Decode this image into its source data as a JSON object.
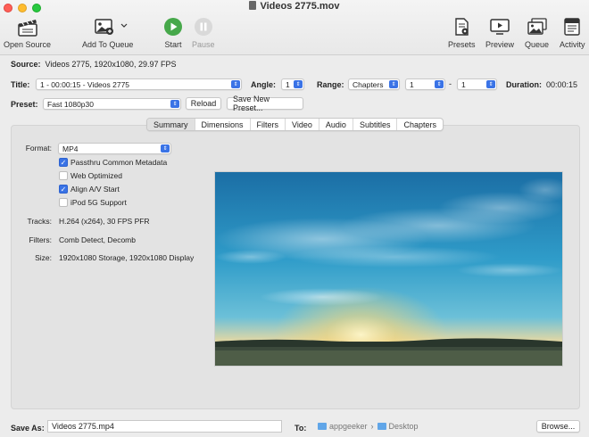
{
  "window": {
    "title": "Videos 2775.mov"
  },
  "toolbar": {
    "open_source": "Open Source",
    "add_to_queue": "Add To Queue",
    "start": "Start",
    "pause": "Pause",
    "presets": "Presets",
    "preview": "Preview",
    "queue": "Queue",
    "activity": "Activity"
  },
  "source": {
    "label": "Source:",
    "value": "Videos 2775, 1920x1080, 29.97 FPS"
  },
  "title_row": {
    "title_label": "Title:",
    "title_value": "1 - 00:00:15 - Videos 2775",
    "angle_label": "Angle:",
    "angle_value": "1",
    "range_label": "Range:",
    "range_value": "Chapters",
    "range_start": "1",
    "range_sep": "-",
    "range_end": "1",
    "duration_label": "Duration:",
    "duration_value": "00:00:15"
  },
  "preset": {
    "label": "Preset:",
    "value": "Fast 1080p30",
    "reload": "Reload",
    "save_new": "Save New Preset..."
  },
  "tabs": [
    "Summary",
    "Dimensions",
    "Filters",
    "Video",
    "Audio",
    "Subtitles",
    "Chapters"
  ],
  "summary": {
    "format_label": "Format:",
    "format_value": "MP4",
    "options": [
      {
        "label": "Passthru Common Metadata",
        "checked": true
      },
      {
        "label": "Web Optimized",
        "checked": false
      },
      {
        "label": "Align A/V Start",
        "checked": true
      },
      {
        "label": "iPod 5G Support",
        "checked": false
      }
    ],
    "tracks_label": "Tracks:",
    "tracks_value": "H.264 (x264), 30 FPS PFR",
    "filters_label": "Filters:",
    "filters_value": "Comb Detect, Decomb",
    "size_label": "Size:",
    "size_value": "1920x1080 Storage, 1920x1080 Display"
  },
  "save": {
    "label": "Save As:",
    "value": "Videos 2775.mp4",
    "to_label": "To:",
    "path": [
      "appgeeker",
      "Desktop"
    ],
    "browse": "Browse..."
  }
}
